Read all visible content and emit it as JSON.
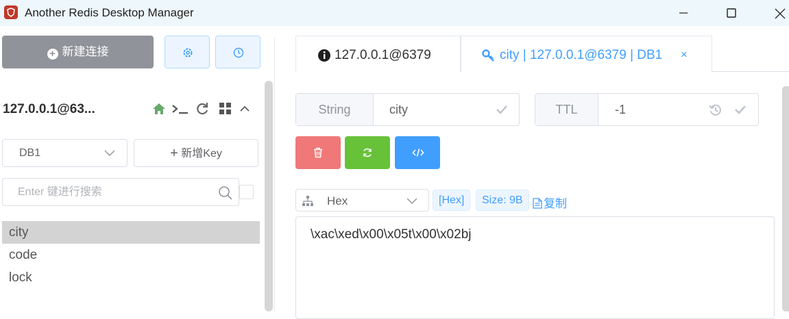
{
  "window": {
    "title": "Another Redis Desktop Manager",
    "controls": [
      "minimize",
      "maximize",
      "close"
    ]
  },
  "sidebar": {
    "new_connection_label": "新建连接",
    "settings_icon": "gear-icon",
    "history_icon": "clock-icon",
    "connection": {
      "name": "127.0.0.1@63...",
      "icons": [
        "home-icon",
        "terminal-icon",
        "refresh-icon",
        "grid-icon",
        "chevron-up-icon"
      ]
    },
    "db_selected": "DB1",
    "add_key_label": "新增Key",
    "search_placeholder": "Enter 键进行搜索",
    "keys": [
      "city",
      "code",
      "lock"
    ],
    "selected_key": "city"
  },
  "tabs": [
    {
      "label": "127.0.0.1@6379",
      "icon": "info-icon",
      "active": false
    },
    {
      "label": "city | 127.0.0.1@6379 | DB1",
      "icon": "key-icon",
      "active": true,
      "close": "×"
    }
  ],
  "editor": {
    "type_label": "String",
    "key_name": "city",
    "ttl_label": "TTL",
    "ttl_value": "-1",
    "buttons": [
      "delete-icon",
      "refresh-icon",
      "code-icon"
    ],
    "format_selected": "Hex",
    "format_tag": "[Hex]",
    "size_tag": "Size: 9B",
    "copy_label": "复制",
    "value": "\\xac\\xed\\x00\\x05t\\x00\\x02bj",
    "colors": {
      "danger": "#f56c6c",
      "success": "#67c23a",
      "primary": "#409eff",
      "info": "#909399"
    }
  }
}
